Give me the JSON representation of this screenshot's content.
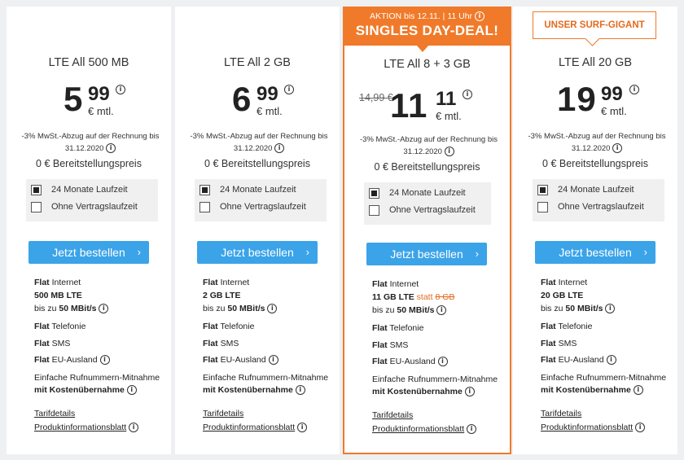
{
  "plans": [
    {
      "name": "LTE All 500 MB",
      "price_main": "5",
      "price_cents": "99",
      "price_unit": "€ mtl.",
      "tax_note_1": "-3% MwSt.-Abzug auf der Rechnung bis",
      "tax_note_2": "31.12.2020",
      "setup": "0 € Bereitstellungspreis",
      "option_1": "24 Monate Laufzeit",
      "option_2": "Ohne Vertragslaufzeit",
      "option_selected": 1,
      "button": "Jetzt bestellen",
      "flat_1": "Flat",
      "internet": " Internet",
      "data_volume": "500 MB LTE",
      "speed_prefix": "bis zu ",
      "speed": "50 MBit/s",
      "telefonie": " Telefonie",
      "sms": " SMS",
      "eu": " EU-Ausland",
      "porting_1": "Einfache Rufnummern-Mitnahme",
      "porting_2": "mit Kostenübernahme",
      "link_1": "Tarifdetails",
      "link_2": "Produktinformationsblatt"
    },
    {
      "name": "LTE All 2 GB",
      "price_main": "6",
      "price_cents": "99",
      "price_unit": "€ mtl.",
      "tax_note_1": "-3% MwSt.-Abzug auf der Rechnung bis",
      "tax_note_2": "31.12.2020",
      "setup": "0 € Bereitstellungspreis",
      "option_1": "24 Monate Laufzeit",
      "option_2": "Ohne Vertragslaufzeit",
      "option_selected": 1,
      "button": "Jetzt bestellen",
      "flat_1": "Flat",
      "internet": " Internet",
      "data_volume": "2 GB LTE",
      "speed_prefix": "bis zu ",
      "speed": "50 MBit/s",
      "telefonie": " Telefonie",
      "sms": " SMS",
      "eu": " EU-Ausland",
      "porting_1": "Einfache Rufnummern-Mitnahme",
      "porting_2": "mit Kostenübernahme",
      "link_1": "Tarifdetails",
      "link_2": "Produktinformationsblatt"
    },
    {
      "name": "LTE All 8 + 3 GB",
      "old_price": "14,99 €",
      "price_main": "11",
      "price_cents": "11",
      "price_unit": "€ mtl.",
      "tax_note_1": "-3% MwSt.-Abzug auf der Rechnung bis",
      "tax_note_2": "31.12.2020",
      "setup": "0 € Bereitstellungspreis",
      "option_1": "24 Monate Laufzeit",
      "option_2": "Ohne Vertragslaufzeit",
      "option_selected": 1,
      "button": "Jetzt bestellen",
      "flat_1": "Flat",
      "internet": " Internet",
      "data_volume": "11 GB LTE",
      "data_statt": " statt ",
      "data_old": "8 GB",
      "speed_prefix": "bis zu ",
      "speed": "50 MBit/s",
      "telefonie": " Telefonie",
      "sms": " SMS",
      "eu": " EU-Ausland",
      "porting_1": "Einfache Rufnummern-Mitnahme",
      "porting_2": "mit Kostenübernahme",
      "link_1": "Tarifdetails",
      "link_2": "Produktinformationsblatt",
      "badge_line_1": "AKTION bis 12.11. | 11 Uhr",
      "badge_line_2": "SINGLES DAY-DEAL!"
    },
    {
      "name": "LTE All 20 GB",
      "price_main": "19",
      "price_cents": "99",
      "price_unit": "€ mtl.",
      "tax_note_1": "-3% MwSt.-Abzug auf der Rechnung bis",
      "tax_note_2": "31.12.2020",
      "setup": "0 € Bereitstellungspreis",
      "option_1": "24 Monate Laufzeit",
      "option_2": "Ohne Vertragslaufzeit",
      "option_selected": 1,
      "button": "Jetzt bestellen",
      "flat_1": "Flat",
      "internet": " Internet",
      "data_volume": "20 GB LTE",
      "speed_prefix": "bis zu ",
      "speed": "50 MBit/s",
      "telefonie": " Telefonie",
      "sms": " SMS",
      "eu": " EU-Ausland",
      "porting_1": "Einfache Rufnummern-Mitnahme",
      "porting_2": "mit Kostenübernahme",
      "link_1": "Tarifdetails",
      "link_2": "Produktinformationsblatt",
      "badge_outline": "UNSER SURF-GIGANT"
    }
  ],
  "icons": {
    "info": "info-icon",
    "chevron": "chevron-right-icon",
    "checkbox": "checkbox"
  },
  "info_glyph": "i",
  "chevron_glyph": "›",
  "colors": {
    "accent_orange": "#f07a2a",
    "button_blue": "#3ba3e8",
    "background": "#eef0f2"
  }
}
